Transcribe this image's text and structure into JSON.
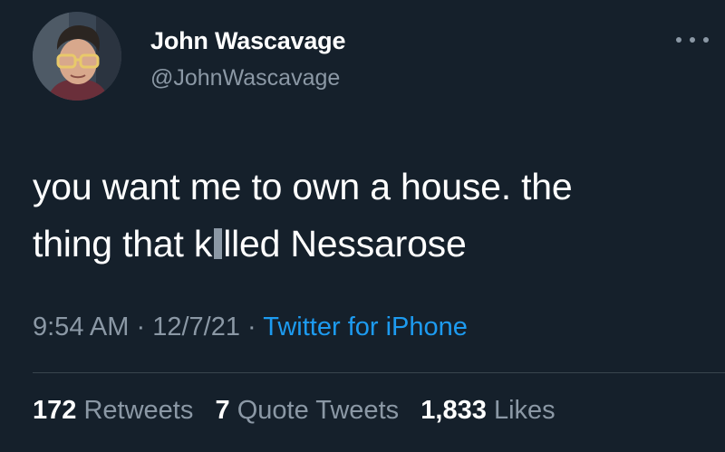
{
  "user": {
    "display_name": "John Wascavage",
    "handle": "@JohnWascavage"
  },
  "more_icon": "more-horizontal-icon",
  "tweet": {
    "line1": "you want me to own a house. the",
    "line2_before": "thing that k",
    "line2_after": "lled Nessarose"
  },
  "meta": {
    "time": "9:54 AM",
    "date": "12/7/21",
    "separator": "·",
    "source": "Twitter for iPhone"
  },
  "stats": {
    "retweets_count": "172",
    "retweets_label": "Retweets",
    "quotes_count": "7",
    "quotes_label": "Quote Tweets",
    "likes_count": "1,833",
    "likes_label": "Likes"
  },
  "colors": {
    "background": "#15202b",
    "text": "#ffffff",
    "secondary": "#8b98a5",
    "link": "#1d9bf0",
    "divider": "#38444d"
  }
}
